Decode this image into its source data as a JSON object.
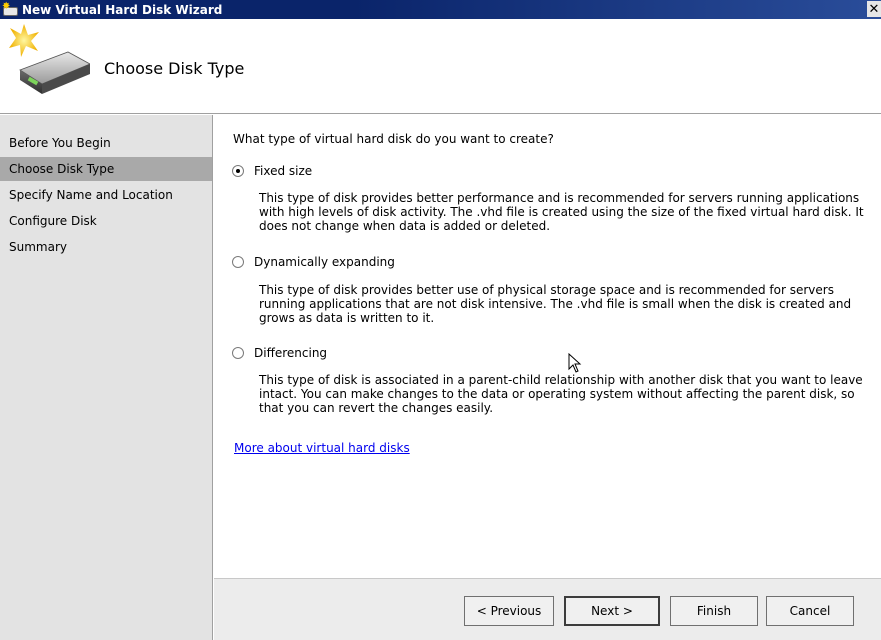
{
  "window": {
    "title": "New Virtual Hard Disk Wizard",
    "close_glyph": "✕",
    "app_icon": "virtual-hard-disk-icon",
    "title_bar_color": "#0a246a"
  },
  "header": {
    "title": "Choose Disk Type",
    "icon": "hard-disk-new-icon"
  },
  "steps": [
    {
      "label": "Before You Begin"
    },
    {
      "label": "Choose Disk Type",
      "active": true
    },
    {
      "label": "Specify Name and Location"
    },
    {
      "label": "Configure Disk"
    },
    {
      "label": "Summary"
    }
  ],
  "main": {
    "question": "What type of virtual hard disk do you want to create?",
    "options": [
      {
        "label": "Fixed size",
        "selected": true,
        "description": "This type of disk provides better performance and is recommended for servers running applications with high levels of disk activity. The .vhd file is created using the size of the fixed virtual hard disk. It does not change when data is added or deleted."
      },
      {
        "label": "Dynamically expanding",
        "selected": false,
        "description": "This type of disk provides better use of physical storage space and is recommended for servers running applications that are not disk intensive. The .vhd file is small when the disk is created and grows as data is written to it."
      },
      {
        "label": "Differencing",
        "selected": false,
        "description": "This type of disk is associated in a parent-child relationship with another disk that you want to leave intact. You can make changes to the data or operating system without affecting the parent disk, so that you can revert the changes easily."
      }
    ],
    "help_link": "More about virtual hard disks"
  },
  "buttons": {
    "previous": "< Previous",
    "next": "Next >",
    "finish": "Finish",
    "cancel": "Cancel"
  },
  "colors": {
    "active_step_bg": "#a9a9a9",
    "left_pane_bg": "#e3e3e3",
    "link": "#0000ee"
  }
}
